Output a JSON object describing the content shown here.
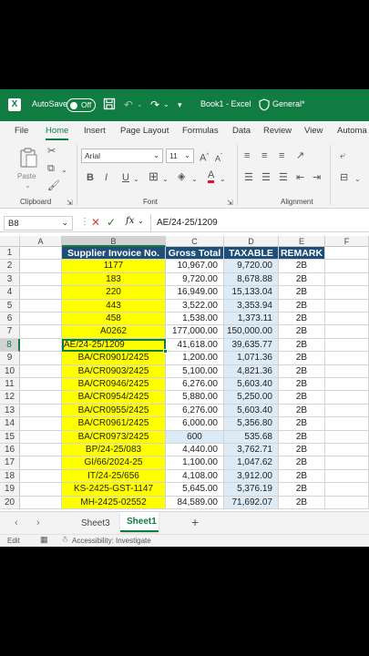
{
  "titlebar": {
    "autosave_label": "AutoSave",
    "autosave_state": "Off",
    "doc_title": "Book1 - Excel",
    "sensitivity": "General*"
  },
  "tabs": [
    "File",
    "Home",
    "Insert",
    "Page Layout",
    "Formulas",
    "Data",
    "Review",
    "View",
    "Automa"
  ],
  "ribbon": {
    "paste_label": "Paste",
    "clipboard_label": "Clipboard",
    "font_label": "Font",
    "alignment_label": "Alignment",
    "font_name": "Arial",
    "font_size": "11",
    "grow_font": "A",
    "shrink_font": "A",
    "bold": "B",
    "italic": "I",
    "underline": "U",
    "font_color": "A"
  },
  "formula_bar": {
    "name_box": "B8",
    "fx": "fx",
    "content": "AE/24-25/1209"
  },
  "columns": [
    "A",
    "B",
    "C",
    "D",
    "E",
    "F"
  ],
  "table": {
    "headers": [
      "Supplier Invoice No.",
      "Gross Total",
      "TAXABLE",
      "REMARK"
    ],
    "rows": [
      {
        "row": "2",
        "invoice": "1177",
        "gross": "10,967.00",
        "taxable": "9,720.00",
        "remark": "2B"
      },
      {
        "row": "3",
        "invoice": "183",
        "gross": "9,720.00",
        "taxable": "8,678.88",
        "remark": "2B"
      },
      {
        "row": "4",
        "invoice": "220",
        "gross": "16,949.00",
        "taxable": "15,133.04",
        "remark": "2B"
      },
      {
        "row": "5",
        "invoice": "443",
        "gross": "3,522.00",
        "taxable": "3,353.94",
        "remark": "2B"
      },
      {
        "row": "6",
        "invoice": "458",
        "gross": "1,538.00",
        "taxable": "1,373.11",
        "remark": "2B"
      },
      {
        "row": "7",
        "invoice": "A0262",
        "gross": "177,000.00",
        "taxable": "150,000.00",
        "remark": "2B"
      },
      {
        "row": "8",
        "invoice": "AE/24-25/1209",
        "gross": "41,618.00",
        "taxable": "39,635.77",
        "remark": "2B"
      },
      {
        "row": "9",
        "invoice": "BA/CR0901/2425",
        "gross": "1,200.00",
        "taxable": "1,071.36",
        "remark": "2B"
      },
      {
        "row": "10",
        "invoice": "BA/CR0903/2425",
        "gross": "5,100.00",
        "taxable": "4,821.36",
        "remark": "2B"
      },
      {
        "row": "11",
        "invoice": "BA/CR0946/2425",
        "gross": "6,276.00",
        "taxable": "5,603.40",
        "remark": "2B"
      },
      {
        "row": "12",
        "invoice": "BA/CR0954/2425",
        "gross": "5,880.00",
        "taxable": "5,250.00",
        "remark": "2B"
      },
      {
        "row": "13",
        "invoice": "BA/CR0955/2425",
        "gross": "6,276.00",
        "taxable": "5,603.40",
        "remark": "2B"
      },
      {
        "row": "14",
        "invoice": "BA/CR0961/2425",
        "gross": "6,000.00",
        "taxable": "5,356.80",
        "remark": "2B"
      },
      {
        "row": "15",
        "invoice": "BA/CR0973/2425",
        "gross": "600",
        "taxable": "535.68",
        "remark": "2B"
      },
      {
        "row": "16",
        "invoice": "BP/24-25/083",
        "gross": "4,440.00",
        "taxable": "3,762.71",
        "remark": "2B"
      },
      {
        "row": "17",
        "invoice": "GI/66/2024-25",
        "gross": "1,100.00",
        "taxable": "1,047.62",
        "remark": "2B"
      },
      {
        "row": "18",
        "invoice": "IT/24-25/656",
        "gross": "4,108.00",
        "taxable": "3,912.00",
        "remark": "2B"
      },
      {
        "row": "19",
        "invoice": "KS-2425-GST-1147",
        "gross": "5,645.00",
        "taxable": "5,376.19",
        "remark": "2B"
      },
      {
        "row": "20",
        "invoice": "MH-2425-02552",
        "gross": "84,589.00",
        "taxable": "71,692.07",
        "remark": "2B"
      }
    ]
  },
  "sheet_tabs": [
    "Sheet3",
    "Sheet1"
  ],
  "active_sheet": "Sheet1",
  "status": {
    "mode": "Edit",
    "accessibility": "Accessibility: Investigate"
  },
  "colors": {
    "excel_green": "#107c41",
    "header_blue": "#1f4e79",
    "yellow": "#ffff00",
    "light_blue": "#ddebf7"
  }
}
